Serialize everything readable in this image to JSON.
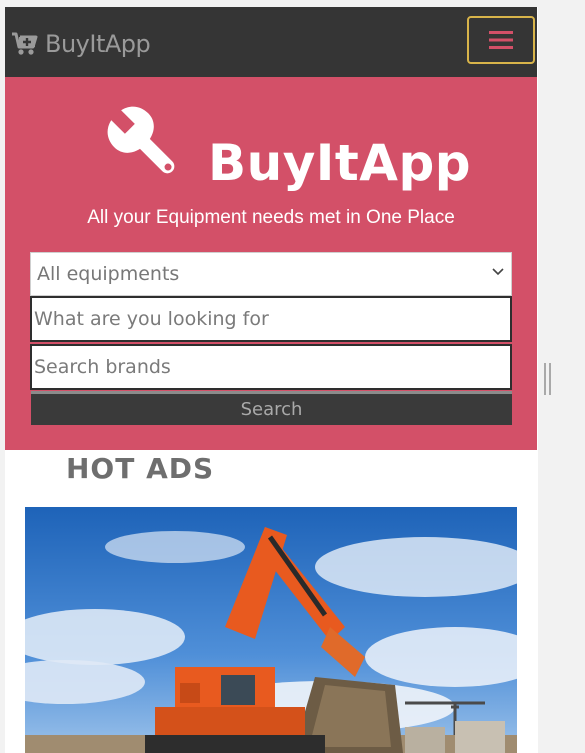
{
  "navbar": {
    "brand_label": "BuyItApp",
    "brand_icon": "cart-plus-icon",
    "menu_icon": "hamburger-menu-icon"
  },
  "hero": {
    "title": "BuyItApp",
    "logo_icon": "wrench-icon",
    "tagline": "All your Equipment needs met in One Place",
    "category_select": {
      "selected": "All equipments"
    },
    "query_input": {
      "placeholder": "What are you looking for"
    },
    "brand_input": {
      "placeholder": "Search brands"
    },
    "search_label": "Search"
  },
  "hot_ads": {
    "title": "HOT ADS"
  },
  "colors": {
    "navbar_bg": "#353535",
    "hero_bg": "#d35068",
    "menu_border": "#d8b44a",
    "menu_icon": "#d35068"
  }
}
